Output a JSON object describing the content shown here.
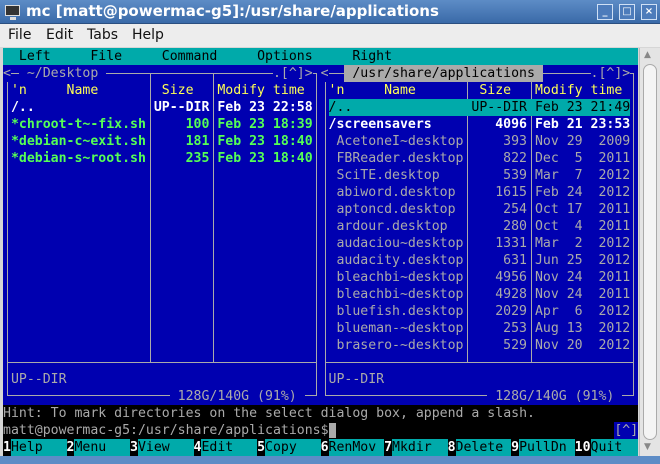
{
  "window": {
    "title": "mc [matt@powermac-g5]:/usr/share/applications",
    "icon": "terminal-icon",
    "buttons": [
      "_",
      "□",
      "×"
    ]
  },
  "app_menu": [
    "File",
    "Edit",
    "Tabs",
    "Help"
  ],
  "mc_menu": [
    "Left",
    "File",
    "Command",
    "Options",
    "Right"
  ],
  "left_panel": {
    "path": " ~/Desktop ",
    "corner": ".[^]>",
    "open": "<",
    "headers": {
      "n": "'n",
      "name": "Name",
      "size": "Size",
      "time": "Modify time"
    },
    "rows": [
      {
        "name": "/..",
        "size": "UP--DIR",
        "time": "Feb 23 22:58",
        "style": "wht"
      },
      {
        "name": "*chroot-t~-fix.sh",
        "size": "100",
        "time": "Feb 23 18:39",
        "style": "grn"
      },
      {
        "name": "*debian-c~exit.sh",
        "size": "181",
        "time": "Feb 23 18:40",
        "style": "grn"
      },
      {
        "name": "*debian-s~root.sh",
        "size": "235",
        "time": "Feb 23 18:40",
        "style": "grn"
      }
    ],
    "status": "UP--DIR",
    "disk": " 128G/140G (91%) "
  },
  "right_panel": {
    "path": " /usr/share/applications ",
    "corner": ".[^]>",
    "open": "<",
    "headers": {
      "n": "'n",
      "name": "Name",
      "size": "Size",
      "time": "Modify time"
    },
    "rows": [
      {
        "name": "/..",
        "size": "UP--DIR",
        "time": "Feb 23 21:49",
        "style": "sel"
      },
      {
        "name": "/screensavers",
        "size": "4096",
        "time": "Feb 21 23:53",
        "style": "wht"
      },
      {
        "name": " AcetoneI~desktop",
        "size": "393",
        "time": "Nov 29  2009",
        "style": "gray"
      },
      {
        "name": " FBReader.desktop",
        "size": "822",
        "time": "Dec  5  2011",
        "style": "gray"
      },
      {
        "name": " SciTE.desktop",
        "size": "539",
        "time": "Mar  7  2012",
        "style": "gray"
      },
      {
        "name": " abiword.desktop",
        "size": "1615",
        "time": "Feb 24  2012",
        "style": "gray"
      },
      {
        "name": " aptoncd.desktop",
        "size": "254",
        "time": "Oct 17  2011",
        "style": "gray"
      },
      {
        "name": " ardour.desktop",
        "size": "280",
        "time": "Oct  4  2011",
        "style": "gray"
      },
      {
        "name": " audaciou~desktop",
        "size": "1331",
        "time": "Mar  2  2012",
        "style": "gray"
      },
      {
        "name": " audacity.desktop",
        "size": "631",
        "time": "Jun 25  2012",
        "style": "gray"
      },
      {
        "name": " bleachbi~desktop",
        "size": "4956",
        "time": "Nov 24  2011",
        "style": "gray"
      },
      {
        "name": " bleachbi~desktop",
        "size": "4928",
        "time": "Nov 24  2011",
        "style": "gray"
      },
      {
        "name": " bluefish.desktop",
        "size": "2029",
        "time": "Apr  6  2012",
        "style": "gray"
      },
      {
        "name": " blueman-~desktop",
        "size": "253",
        "time": "Aug 13  2012",
        "style": "gray"
      },
      {
        "name": " brasero-~desktop",
        "size": "529",
        "time": "Nov 20  2012",
        "style": "gray"
      }
    ],
    "status": "UP--DIR",
    "disk": " 128G/140G (91%) "
  },
  "hint": "Hint: To mark directories on the select dialog box, append a slash.",
  "prompt": "matt@powermac-g5:/usr/share/applications$ ",
  "prompt_corner": "[^]",
  "fkeys": [
    {
      "n": "1",
      "label": "Help"
    },
    {
      "n": "2",
      "label": "Menu"
    },
    {
      "n": "3",
      "label": "View"
    },
    {
      "n": "4",
      "label": "Edit"
    },
    {
      "n": "5",
      "label": "Copy"
    },
    {
      "n": "6",
      "label": "RenMov"
    },
    {
      "n": "7",
      "label": "Mkdir"
    },
    {
      "n": "8",
      "label": "Delete"
    },
    {
      "n": "9",
      "label": "PullDn"
    },
    {
      "n": "10",
      "label": "Quit"
    }
  ],
  "colors": {
    "panel_bg": "#0000b0",
    "cyan": "#00aaaa",
    "text": "#aaaaaa",
    "header": "#ffff55",
    "exec": "#55ff55"
  }
}
